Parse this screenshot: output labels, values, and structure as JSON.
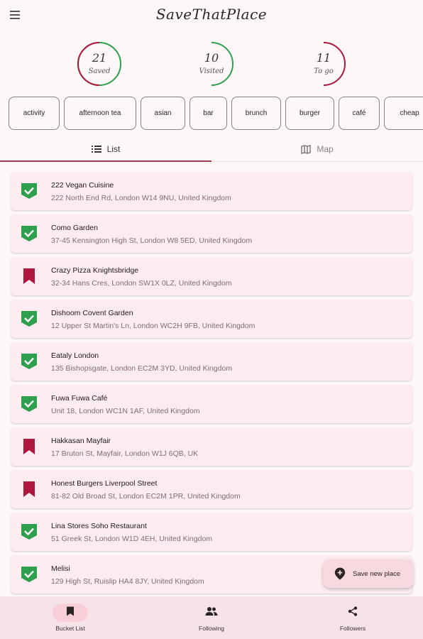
{
  "app": {
    "title": "SaveThatPlace"
  },
  "stats": [
    {
      "value": "21",
      "label": "Saved"
    },
    {
      "value": "10",
      "label": "Visited"
    },
    {
      "value": "11",
      "label": "To go"
    }
  ],
  "filters": [
    "activity",
    "afternoon tea",
    "asian",
    "bar",
    "brunch",
    "burger",
    "café",
    "cheap"
  ],
  "tabs": {
    "list": "List",
    "map": "Map",
    "active": "List"
  },
  "places": [
    {
      "name": "222 Vegan Cuisine",
      "address": "222 North End Rd, London W14 9NU, United Kingdom",
      "status": "visited"
    },
    {
      "name": "Como Garden",
      "address": "37-45 Kensington High St, London W8 5ED, United Kingdom",
      "status": "visited"
    },
    {
      "name": "Crazy Pizza Knightsbridge",
      "address": "32-34 Hans Cres, London SW1X 0LZ, United Kingdom",
      "status": "to-go"
    },
    {
      "name": "Dishoom Covent Garden",
      "address": "12 Upper St Martin's Ln, London WC2H 9FB, United Kingdom",
      "status": "visited"
    },
    {
      "name": "Eataly London",
      "address": "135 Bishopsgate, London EC2M 3YD, United Kingdom",
      "status": "visited"
    },
    {
      "name": "Fuwa Fuwa Café",
      "address": "Unit 18, London WC1N 1AF, United Kingdom",
      "status": "visited"
    },
    {
      "name": "Hakkasan Mayfair",
      "address": "17 Bruton St, Mayfair, London W1J 6QB, UK",
      "status": "to-go"
    },
    {
      "name": "Honest Burgers Liverpool Street",
      "address": "81-82 Old Broad St, London EC2M 1PR, United Kingdom",
      "status": "to-go"
    },
    {
      "name": "Lina Stores Soho Restaurant",
      "address": "51 Greek St, London W1D 4EH, United Kingdom",
      "status": "visited"
    },
    {
      "name": "Melisi",
      "address": "129 High St, Ruislip HA4 8JY, United Kingdom",
      "status": "visited"
    }
  ],
  "fab": {
    "label": "Save new place",
    "icon": "add-location-icon"
  },
  "bottom_nav": [
    {
      "label": "Bucket List",
      "icon": "bookmark-icon",
      "active": true
    },
    {
      "label": "Following",
      "icon": "people-icon",
      "active": false
    },
    {
      "label": "Followers",
      "icon": "share-icon",
      "active": false
    }
  ],
  "colors": {
    "visited": "#2e9e4f",
    "to_go": "#b0173e",
    "accent": "#9c3d54",
    "card": "#fcecf0"
  }
}
